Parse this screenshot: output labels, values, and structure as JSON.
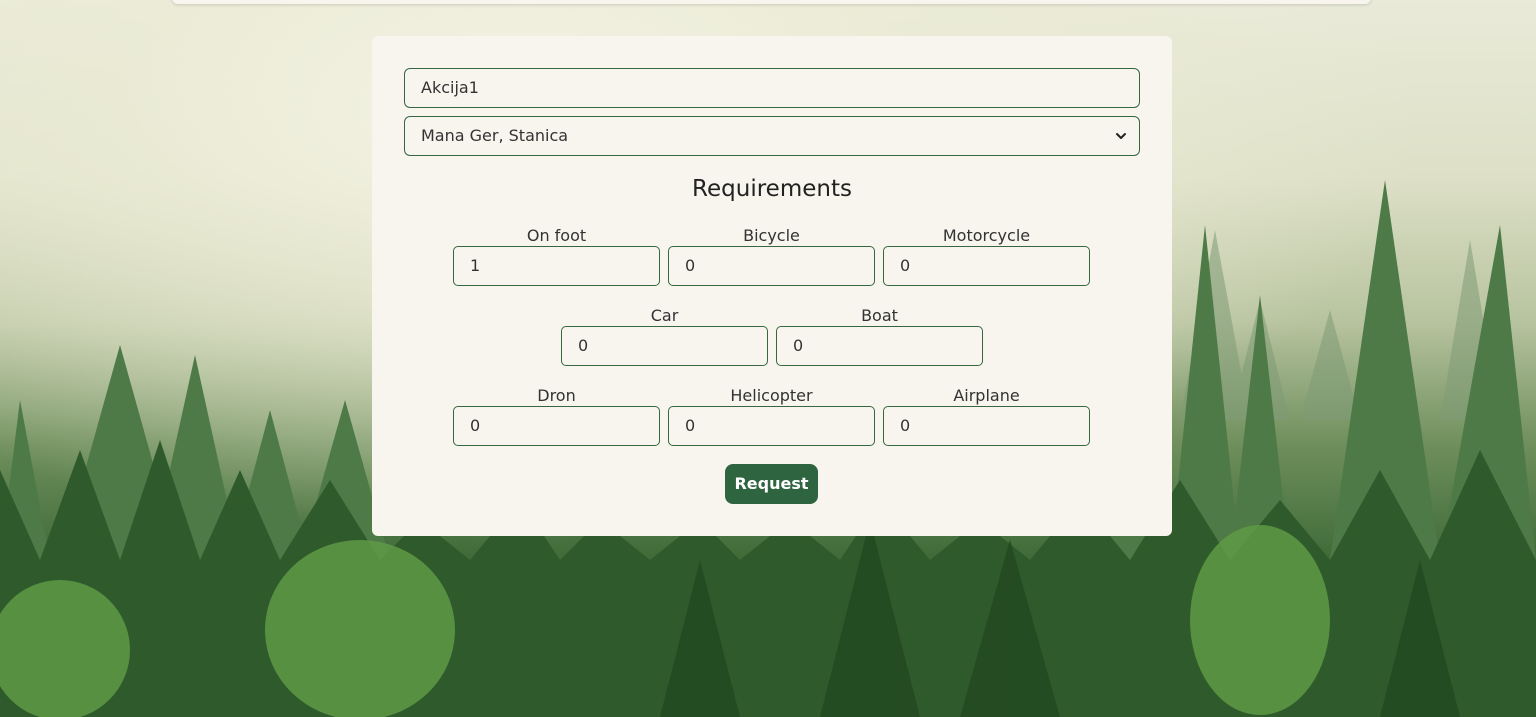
{
  "action": {
    "name_value": "Akcija1",
    "station_selected": "Mana Ger, Stanica"
  },
  "requirements": {
    "title": "Requirements",
    "items": [
      {
        "label": "On foot",
        "value": "1"
      },
      {
        "label": "Bicycle",
        "value": "0"
      },
      {
        "label": "Motorcycle",
        "value": "0"
      },
      {
        "label": "Car",
        "value": "0"
      },
      {
        "label": "Boat",
        "value": "0"
      },
      {
        "label": "Dron",
        "value": "0"
      },
      {
        "label": "Helicopter",
        "value": "0"
      },
      {
        "label": "Airplane",
        "value": "0"
      }
    ],
    "button_label": "Request"
  },
  "icons": {
    "select": "chevron-down-icon"
  },
  "colors": {
    "accent": "#2f6440",
    "border": "#35683f",
    "card": "#f7f5ee"
  }
}
